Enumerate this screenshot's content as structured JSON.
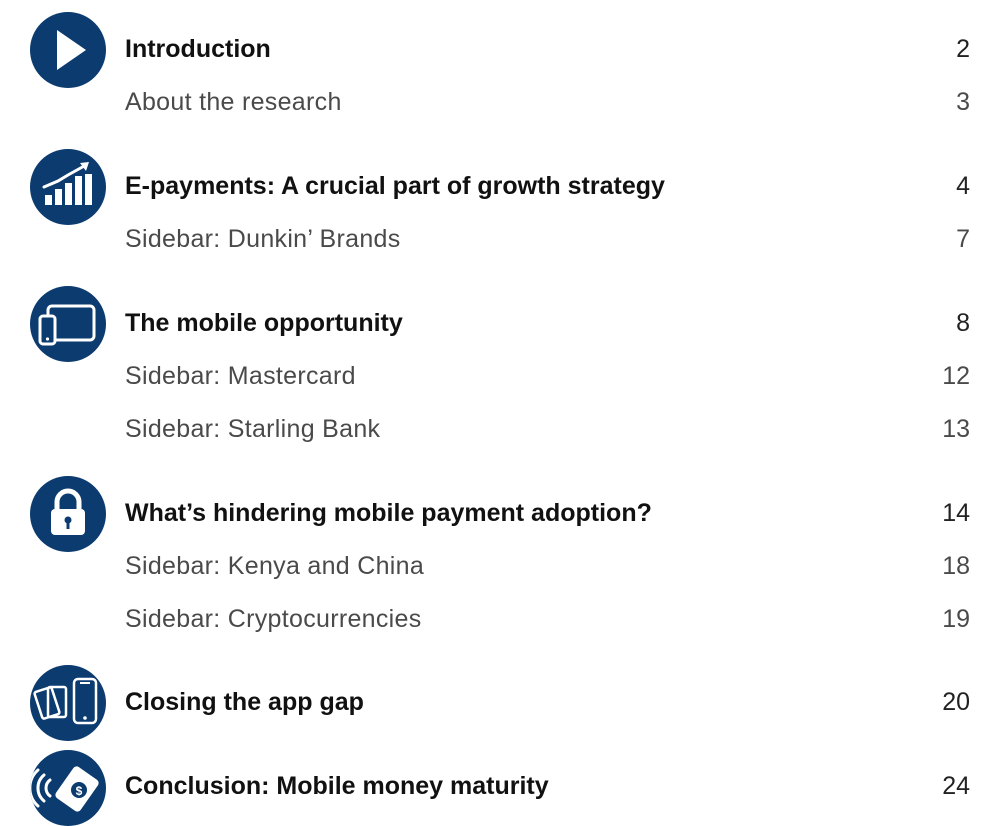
{
  "toc": {
    "sections": [
      {
        "icon": "play-icon",
        "title": "Introduction",
        "page": "2",
        "subs": [
          {
            "title": "About the research",
            "page": "3"
          }
        ]
      },
      {
        "icon": "growth-chart-icon",
        "title": "E-payments: A crucial part of growth strategy",
        "page": "4",
        "subs": [
          {
            "title": "Sidebar: Dunkin’ Brands",
            "page": "7"
          }
        ]
      },
      {
        "icon": "tablet-phone-icon",
        "title": "The mobile opportunity",
        "page": "8",
        "subs": [
          {
            "title": "Sidebar: Mastercard",
            "page": "12"
          },
          {
            "title": "Sidebar: Starling Bank",
            "page": "13"
          }
        ]
      },
      {
        "icon": "padlock-icon",
        "title": "What’s hindering mobile payment adoption?",
        "page": "14",
        "subs": [
          {
            "title": "Sidebar: Kenya and China",
            "page": "18"
          },
          {
            "title": "Sidebar: Cryptocurrencies",
            "page": "19"
          }
        ]
      },
      {
        "icon": "cards-phone-icon",
        "title": "Closing the app gap",
        "page": "20",
        "subs": []
      },
      {
        "icon": "contactless-payment-icon",
        "title": "Conclusion: Mobile money maturity",
        "page": "24",
        "subs": []
      }
    ]
  },
  "colors": {
    "icon_background": "#0b3b6f",
    "icon_foreground": "#ffffff"
  }
}
